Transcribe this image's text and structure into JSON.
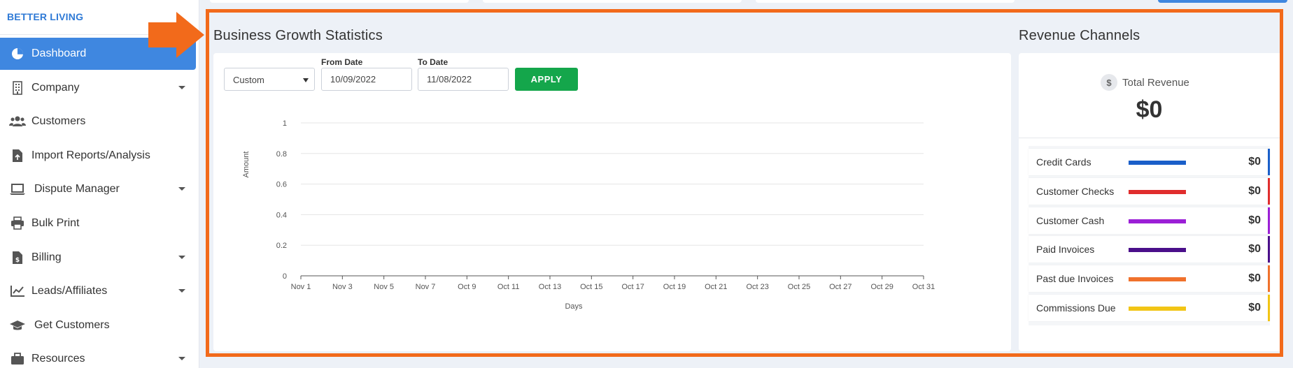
{
  "sidebar": {
    "brand": "BETTER LIVING",
    "items": [
      {
        "label": "Dashboard",
        "icon": "pie-chart-icon",
        "active": true,
        "has_submenu": false
      },
      {
        "label": "Company",
        "icon": "building-icon",
        "active": false,
        "has_submenu": true
      },
      {
        "label": "Customers",
        "icon": "users-icon",
        "active": false,
        "has_submenu": false
      },
      {
        "label": "Import Reports/Analysis",
        "icon": "file-upload-icon",
        "active": false,
        "has_submenu": false
      },
      {
        "label": "Dispute Manager",
        "icon": "laptop-icon",
        "active": false,
        "has_submenu": true
      },
      {
        "label": "Bulk Print",
        "icon": "printer-icon",
        "active": false,
        "has_submenu": false
      },
      {
        "label": "Billing",
        "icon": "invoice-icon",
        "active": false,
        "has_submenu": true
      },
      {
        "label": "Leads/Affiliates",
        "icon": "chart-line-icon",
        "active": false,
        "has_submenu": true
      },
      {
        "label": "Get Customers",
        "icon": "graduation-cap-icon",
        "active": false,
        "has_submenu": false
      },
      {
        "label": "Resources",
        "icon": "briefcase-icon",
        "active": false,
        "has_submenu": true
      }
    ]
  },
  "growth": {
    "title": "Business Growth Statistics",
    "range_select": {
      "value": "Custom"
    },
    "from_date": {
      "label": "From Date",
      "value": "10/09/2022"
    },
    "to_date": {
      "label": "To Date",
      "value": "11/08/2022"
    },
    "apply_label": "APPLY"
  },
  "chart_data": {
    "type": "line",
    "title": "",
    "xlabel": "Days",
    "ylabel": "Amount",
    "ylim": [
      0,
      1
    ],
    "y_ticks": [
      "0",
      "0.2",
      "0.4",
      "0.6",
      "0.8",
      "1"
    ],
    "categories": [
      "Nov 1",
      "Nov 3",
      "Nov 5",
      "Nov 7",
      "Oct 9",
      "Oct 11",
      "Oct 13",
      "Oct 15",
      "Oct 17",
      "Oct 19",
      "Oct 21",
      "Oct 23",
      "Oct 25",
      "Oct 27",
      "Oct 29",
      "Oct 31"
    ],
    "grid": true,
    "series": []
  },
  "revenue": {
    "title": "Revenue Channels",
    "total_label": "Total Revenue",
    "total_icon": "dollar-icon",
    "total_value": "$0",
    "channels": [
      {
        "name": "Credit Cards",
        "amount": "$0",
        "color": "#1a5fc9"
      },
      {
        "name": "Customer Checks",
        "amount": "$0",
        "color": "#e02d2d"
      },
      {
        "name": "Customer Cash",
        "amount": "$0",
        "color": "#9b1fd6"
      },
      {
        "name": "Paid Invoices",
        "amount": "$0",
        "color": "#4a0f8a"
      },
      {
        "name": "Past due Invoices",
        "amount": "$0",
        "color": "#f0712c"
      },
      {
        "name": "Commissions Due",
        "amount": "$0",
        "color": "#f2c515"
      }
    ]
  },
  "colors": {
    "accent": "#3f87e0",
    "highlight_frame": "#f26a1b",
    "apply_button": "#14a64b"
  }
}
